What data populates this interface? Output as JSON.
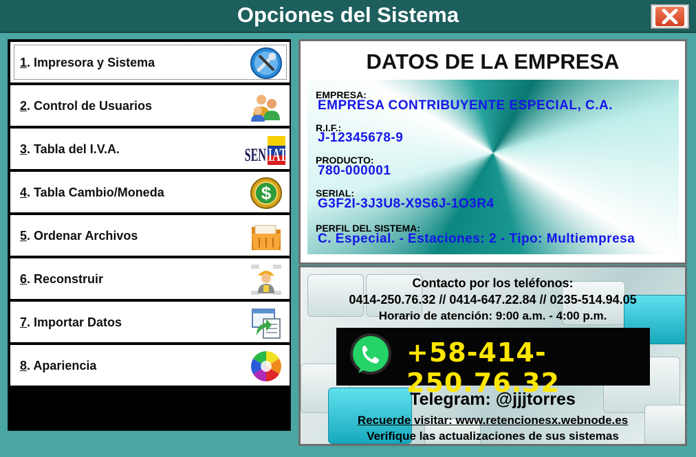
{
  "window": {
    "title": "Opciones del Sistema",
    "close_label": "Cerrar"
  },
  "menu": {
    "items": [
      {
        "num": "1",
        "label": ". Impresora y Sistema",
        "icon": "tools-icon"
      },
      {
        "num": "2",
        "label": ". Control de Usuarios",
        "icon": "users-icon"
      },
      {
        "num": "3",
        "label": ". Tabla del I.V.A.",
        "icon": "seniat-logo-icon"
      },
      {
        "num": "4",
        "label": ". Tabla Cambio/Moneda",
        "icon": "dollar-coin-icon"
      },
      {
        "num": "5",
        "label": ". Ordenar Archivos",
        "icon": "folder-icon"
      },
      {
        "num": "6",
        "label": ". Reconstruir",
        "icon": "worker-icon"
      },
      {
        "num": "7",
        "label": ". Importar Datos",
        "icon": "import-data-icon"
      },
      {
        "num": "8",
        "label": ". Apariencia",
        "icon": "color-wheel-icon"
      }
    ]
  },
  "empresa": {
    "title": "DATOS DE LA EMPRESA",
    "empresa_label": "EMPRESA:",
    "empresa_value": "EMPRESA CONTRIBUYENTE ESPECIAL, C.A.",
    "rif_label": "R.I.F.:",
    "rif_value": "J-12345678-9",
    "producto_label": "PRODUCTO:",
    "producto_value": "780-000001",
    "serial_label": "SERIAL:",
    "serial_value": "G3F2I-3J3U8-X9S6J-1O3R4",
    "perfil_label": "PERFIL DEL SISTEMA:",
    "perfil_value": "C. Especial. - Estaciones: 2 - Tipo: Multiempresa"
  },
  "contacto": {
    "heading": "Contacto por los teléfonos:",
    "phones": "0414-250.76.32 // 0414-647.22.84 // 0235-514.94.05",
    "horario": "Horario de atención: 9:00 a.m. - 4:00 p.m.",
    "whatsapp": "+58-414-250.76.32",
    "telegram": "Telegram: @jjjtorres",
    "visit": "Recuerde visitar: www.retencionesx.webnode.es",
    "updates": "Verifique las actualizaciones de sus sistemas"
  },
  "colors": {
    "titlebar": "#1d5f5c",
    "frame": "#4aa6a3",
    "value_blue": "#1515e8",
    "whatsapp_yellow": "#ffe600",
    "whatsapp_green": "#25d366"
  }
}
